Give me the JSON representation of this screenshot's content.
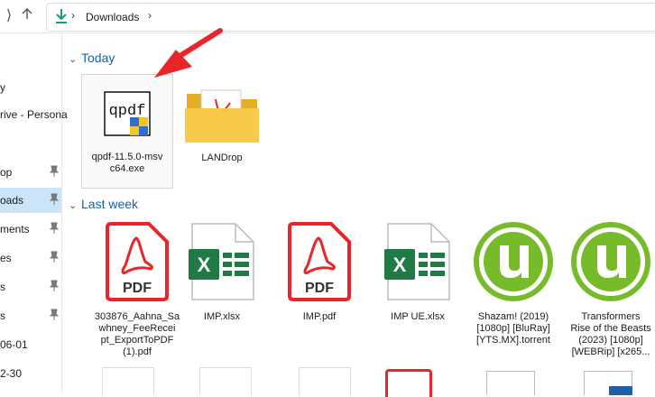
{
  "address": {
    "crumb": "Downloads"
  },
  "sidebar": {
    "items": [
      {
        "label": "y",
        "pinned": false,
        "selected": false
      },
      {
        "label": "rive - Persona",
        "pinned": false,
        "selected": false
      },
      {
        "label": "op",
        "pinned": true,
        "selected": false
      },
      {
        "label": "oads",
        "pinned": true,
        "selected": true
      },
      {
        "label": "ments",
        "pinned": true,
        "selected": false
      },
      {
        "label": "es",
        "pinned": true,
        "selected": false
      },
      {
        "label": "s",
        "pinned": true,
        "selected": false
      },
      {
        "label": "s",
        "pinned": true,
        "selected": false
      },
      {
        "label": "06-01",
        "pinned": false,
        "selected": false
      },
      {
        "label": "2-30",
        "pinned": false,
        "selected": false
      }
    ]
  },
  "groups": {
    "today": "Today",
    "last_week": "Last week"
  },
  "files": {
    "today": [
      {
        "name": "qpdf-11.5.0-msvc64.exe",
        "icon": "qpdf-exe-icon",
        "name_lines": [
          "qpdf-11.5.0-msv",
          "c64.exe"
        ]
      },
      {
        "name": "LANDrop",
        "icon": "folder-icon",
        "name_lines": [
          "LANDrop"
        ]
      }
    ],
    "last_week": [
      {
        "icon": "pdf-icon",
        "name_lines": [
          "303876_Aahna_Sa",
          "whney_FeeRecei",
          "pt_ExportToPDF",
          "(1).pdf"
        ]
      },
      {
        "icon": "excel-icon",
        "name_lines": [
          "IMP.xlsx"
        ]
      },
      {
        "icon": "pdf-icon",
        "name_lines": [
          "IMP.pdf"
        ]
      },
      {
        "icon": "excel-icon",
        "name_lines": [
          "IMP UE.xlsx"
        ]
      },
      {
        "icon": "utorrent-icon",
        "name_lines": [
          "Shazam! (2019)",
          "[1080p] [BluRay]",
          "[YTS.MX].torrent"
        ]
      },
      {
        "icon": "utorrent-icon",
        "name_lines": [
          "Transformers",
          "Rise of the Beasts",
          "(2023) [1080p]",
          "[WEBRip] [x265..."
        ]
      }
    ]
  },
  "icon_labels": {
    "pdf": "PDF",
    "qpdf": "qpdf"
  },
  "colors": {
    "accent": "#1c5fa8",
    "pdf_red": "#e8262a",
    "excel_green": "#1f7a45",
    "utorrent_green": "#77bb2a",
    "arrow_red": "#e8262a",
    "folder_yellow": "#f5c342",
    "selected_bg": "#cce4f7"
  }
}
